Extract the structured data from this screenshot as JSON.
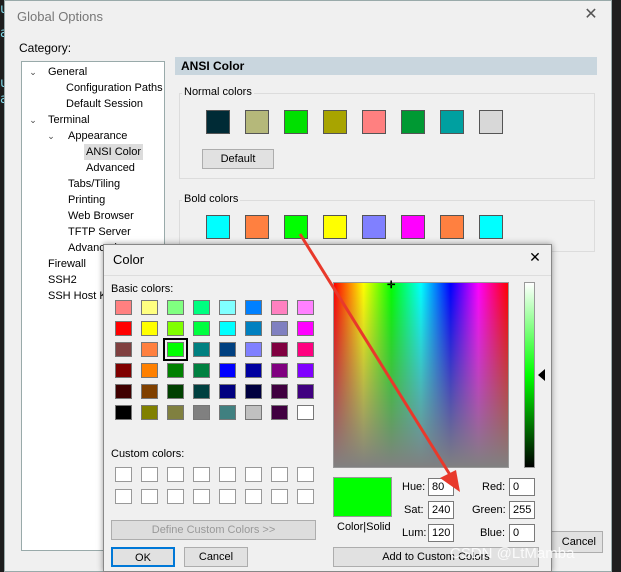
{
  "window": {
    "title": "Global Options",
    "category_label": "Category:",
    "tree": [
      {
        "label": "General",
        "level": 0,
        "expanded": true
      },
      {
        "label": "Configuration Paths",
        "level": 2
      },
      {
        "label": "Default Session",
        "level": 2
      },
      {
        "label": "Terminal",
        "level": 0,
        "expanded": true
      },
      {
        "label": "Appearance",
        "level": 1,
        "expanded": true
      },
      {
        "label": "ANSI Color",
        "level": 2,
        "selected": true
      },
      {
        "label": "Advanced",
        "level": 2
      },
      {
        "label": "Tabs/Tiling",
        "level": 1
      },
      {
        "label": "Printing",
        "level": 1
      },
      {
        "label": "Web Browser",
        "level": 1
      },
      {
        "label": "TFTP Server",
        "level": 1
      },
      {
        "label": "Advanced",
        "level": 1
      },
      {
        "label": "Firewall",
        "level": 0
      },
      {
        "label": "SSH2",
        "level": 0
      },
      {
        "label": "SSH Host Keys",
        "level": 0
      }
    ],
    "panel_title": "ANSI Color",
    "normal_colors_label": "Normal colors",
    "normal_colors": [
      "#002b36",
      "#b5b87a",
      "#00e000",
      "#a8a400",
      "#ff8080",
      "#009933",
      "#00a0a0",
      "#d8d8d8"
    ],
    "default_button": "Default",
    "bold_colors_label": "Bold colors",
    "bold_colors": [
      "#00ffff",
      "#ff8040",
      "#00ff00",
      "#ffff00",
      "#8080ff",
      "#ff00ff",
      "#ff8040",
      "#00ffff"
    ],
    "cancel_partial": "Cancel"
  },
  "color_dialog": {
    "title": "Color",
    "basic_colors_label": "Basic colors:",
    "basic_colors": [
      [
        "#ff8080",
        "#ffff80",
        "#80ff80",
        "#00ff80",
        "#80ffff",
        "#0080ff",
        "#ff80c0",
        "#ff80ff"
      ],
      [
        "#ff0000",
        "#ffff00",
        "#80ff00",
        "#00ff40",
        "#00ffff",
        "#0080c0",
        "#8080c0",
        "#ff00ff"
      ],
      [
        "#804040",
        "#ff8040",
        "#00ff00",
        "#008080",
        "#004080",
        "#8080ff",
        "#800040",
        "#ff0080"
      ],
      [
        "#800000",
        "#ff8000",
        "#008000",
        "#008040",
        "#0000ff",
        "#0000a0",
        "#800080",
        "#8000ff"
      ],
      [
        "#400000",
        "#804000",
        "#004000",
        "#004040",
        "#000080",
        "#000040",
        "#400040",
        "#400080"
      ],
      [
        "#000000",
        "#808000",
        "#808040",
        "#808080",
        "#408080",
        "#c0c0c0",
        "#400040",
        "#ffffff"
      ]
    ],
    "selected_basic": [
      2,
      2
    ],
    "custom_colors_label": "Custom colors:",
    "define_custom": "Define Custom Colors >>",
    "ok": "OK",
    "cancel": "Cancel",
    "color_solid": "Color|Solid",
    "preview_color": "#00ff00",
    "hue_label": "Hue:",
    "hue": "80",
    "sat_label": "Sat:",
    "sat": "240",
    "lum_label": "Lum:",
    "lum": "120",
    "red_label": "Red:",
    "red": "0",
    "green_label": "Green:",
    "green": "255",
    "blue_label": "Blue:",
    "blue": "0",
    "add_custom": "Add to Custom Colors"
  },
  "watermark": "CSDN @LtMamba"
}
